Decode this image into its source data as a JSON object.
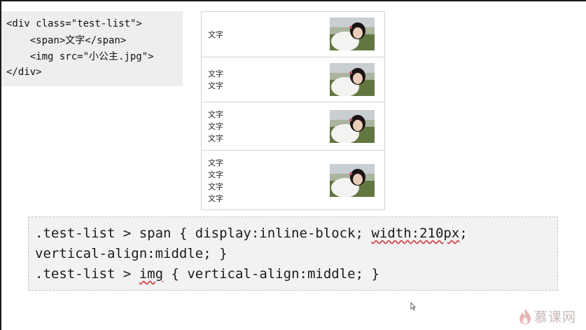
{
  "html_snippet": {
    "lines": [
      "<div class=\"test-list\">",
      "    <span>文字</span>",
      "    <img src=\"小公主.jpg\">",
      "</div>"
    ]
  },
  "demo_rows": [
    {
      "lines": [
        "文字"
      ]
    },
    {
      "lines": [
        "文字",
        "文字"
      ]
    },
    {
      "lines": [
        "文字",
        "文字",
        "文字"
      ]
    },
    {
      "lines": [
        "文字",
        "文字",
        "文字",
        "文字"
      ]
    }
  ],
  "css_snippet": {
    "line1_pre": ".test-list > span { display:inline-block; ",
    "line1_flag": "width:210px",
    "line1_post": ";",
    "line2": "vertical-align:middle; }",
    "line3_pre": ".test-list > ",
    "line3_flag": "img",
    "line3_post": " { vertical-align:middle; }"
  },
  "brand": {
    "name": "慕课网",
    "icon": "flame-logo-icon"
  },
  "colors": {
    "code_bg": "#eeeeef",
    "css_bg": "#f2f2f3",
    "spellcheck": "#d24d4d",
    "brand": "#c9b7b7"
  }
}
